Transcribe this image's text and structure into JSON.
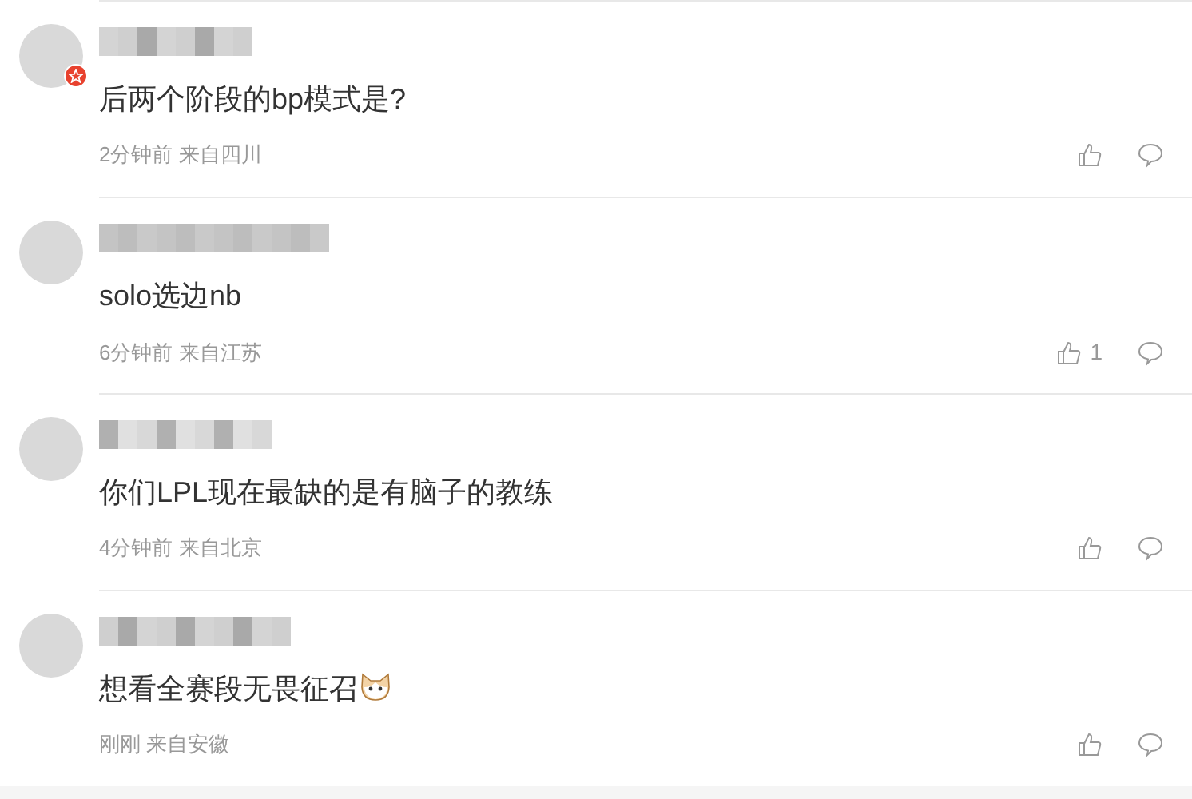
{
  "comments": [
    {
      "badge": true,
      "text": "后两个阶段的bp模式是?",
      "time": "2分钟前",
      "location": "来自四川",
      "emoji": false
    },
    {
      "badge": false,
      "text": "solo选边nb",
      "time": "6分钟前",
      "location": "来自江苏",
      "likes": "1",
      "emoji": false
    },
    {
      "badge": false,
      "text": "你们LPL现在最缺的是有脑子的教练",
      "time": "4分钟前",
      "location": "来自北京",
      "emoji": false
    },
    {
      "badge": false,
      "text": "想看全赛段无畏征召",
      "time": "刚刚",
      "location": "来自安徽",
      "emoji": true
    }
  ]
}
